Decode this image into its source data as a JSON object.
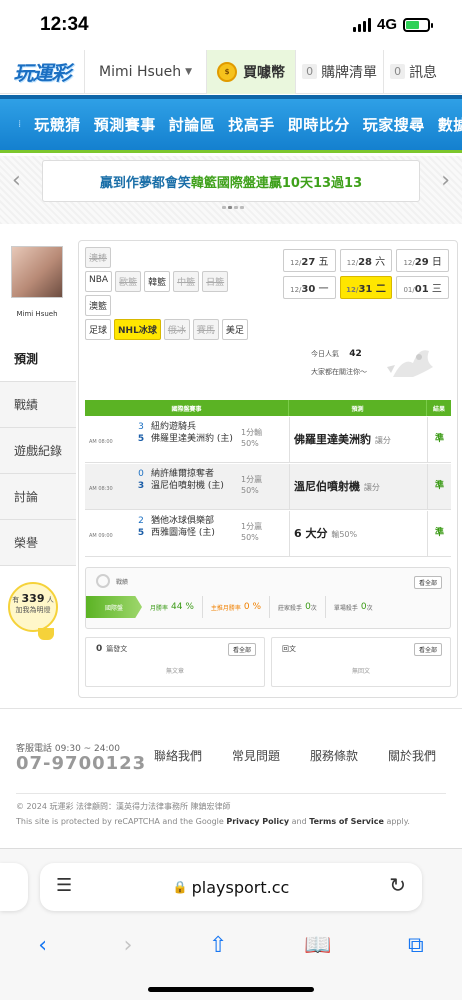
{
  "status_bar": {
    "time": "12:34",
    "network": "4G"
  },
  "header": {
    "logo": "玩運彩",
    "user_name": "Mimi Hsueh",
    "buy_coin": "買噱幣",
    "coin_icon": "coin-icon",
    "cart_count": "0",
    "cart_label": "購牌清單",
    "msg_count": "0",
    "msg_label": "訊息"
  },
  "nav": {
    "items": [
      "玩競猜",
      "預測賽事",
      "討論區",
      "找高手",
      "即時比分",
      "玩家搜尋",
      "數據"
    ]
  },
  "banner": {
    "text_a": "贏到作夢都會笑 ",
    "text_b": "韓籃",
    "text_c": " 國際盤連贏10天13過13"
  },
  "profile": {
    "name": "Mimi Hsueh"
  },
  "side_tabs": [
    "預測",
    "戰績",
    "遊戲紀錄",
    "討論",
    "榮譽"
  ],
  "fans": {
    "prefix": "有",
    "count": "339",
    "suffix": "人",
    "line2": "加我為明燈"
  },
  "categories": {
    "row1": [
      {
        "label": "澳棒",
        "state": "disabled"
      }
    ],
    "row2": [
      {
        "label": "NBA",
        "state": "normal"
      },
      {
        "label": "歐籃",
        "state": "disabled"
      },
      {
        "label": "韓籃",
        "state": "normal"
      },
      {
        "label": "中籃",
        "state": "disabled"
      },
      {
        "label": "日籃",
        "state": "disabled"
      }
    ],
    "row3": [
      {
        "label": "澳籃",
        "state": "normal"
      }
    ],
    "row4": [
      {
        "label": "足球",
        "state": "normal"
      },
      {
        "label": "NHL冰球",
        "state": "selected"
      },
      {
        "label": "俄冰",
        "state": "disabled"
      },
      {
        "label": "賽馬",
        "state": "disabled"
      },
      {
        "label": "美足",
        "state": "normal"
      }
    ]
  },
  "dates": [
    {
      "md": "12/",
      "d": "27",
      "w": "五",
      "sel": false
    },
    {
      "md": "12/",
      "d": "28",
      "w": "六",
      "sel": false
    },
    {
      "md": "12/",
      "d": "29",
      "w": "日",
      "sel": false
    },
    {
      "md": "12/",
      "d": "30",
      "w": "一",
      "sel": false
    },
    {
      "md": "12/",
      "d": "31",
      "w": "二",
      "sel": true
    },
    {
      "md": "01/",
      "d": "01",
      "w": "三",
      "sel": false
    }
  ],
  "popularity": {
    "label": "今日人氣",
    "value": "42",
    "sub": "大家都在關注你～"
  },
  "table": {
    "headers": {
      "game": "國際盤賽事",
      "pick": "預測",
      "result": "結果"
    },
    "rows": [
      {
        "time": "AM 08:00",
        "away_score": "3",
        "away": "紐約遊騎兵",
        "home_score": "5",
        "home": "佛羅里達美洲豹 (主)",
        "odds_a": "1分輸",
        "odds_b": "50%",
        "pick": "佛羅里達美洲豹",
        "pick_type": "讓分",
        "result": "準"
      },
      {
        "time": "AM 08:30",
        "away_score": "0",
        "away": "納許維爾掠奪者",
        "home_score": "3",
        "home": "溫尼伯噴射機 (主)",
        "odds_a": "1分贏",
        "odds_b": "50%",
        "pick": "溫尼伯噴射機",
        "pick_type": "讓分",
        "result": "準"
      },
      {
        "time": "AM 09:00",
        "away_score": "2",
        "away": "猶他冰球俱樂部",
        "home_score": "5",
        "home": "西雅圖海怪 (主)",
        "odds_a": "1分贏",
        "odds_b": "50%",
        "pick": "6 大分",
        "pick_type": "輸50%",
        "result": "準"
      }
    ]
  },
  "record": {
    "title": "戰績",
    "view_all": "看全部",
    "tag": "國際盤",
    "month_rate_label": "月勝率",
    "month_rate": "44 %",
    "main_month_rate_label": "主推月勝率",
    "main_month_rate": "0 %",
    "streak_label": "莊家殺手",
    "streak": "0",
    "streak_unit": "次",
    "single_label": "單場殺手",
    "single": "0",
    "single_unit": "次"
  },
  "posts": {
    "count": "0",
    "label": "篇發文",
    "view_all": "看全部",
    "empty": "無文章"
  },
  "replies": {
    "label": "回文",
    "view_all": "看全部",
    "empty": "無回文"
  },
  "footer": {
    "phone_label": "客服電話 09:30 ~ 24:00",
    "phone": "07-9700123",
    "links": [
      "聯絡我們",
      "常見問題",
      "服務條款",
      "關於我們"
    ],
    "copyright": "© 2024 玩運彩 法律顧問：漢英得力法律事務所 陳鎮宏律師",
    "recaptcha_a": "This site is protected by reCAPTCHA and the Google ",
    "privacy": "Privacy Policy",
    "and": " and ",
    "terms": "Terms of Service",
    "apply": " apply."
  },
  "browser": {
    "url": "playsport.cc"
  },
  "colors": {
    "nav_blue": "#1480cf",
    "green": "#5bb324",
    "yellow": "#ffe600",
    "win": "#3a9a15"
  }
}
